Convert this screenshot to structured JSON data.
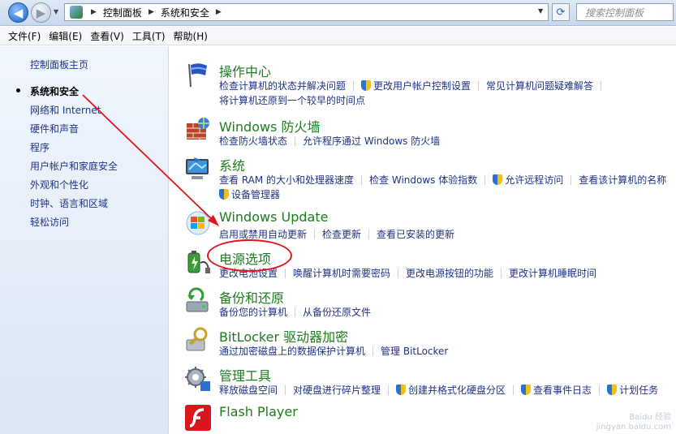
{
  "address_bar": {
    "crumbs": [
      "控制面板",
      "系统和安全"
    ],
    "search_placeholder": "搜索控制面板"
  },
  "menu": [
    "文件(F)",
    "编辑(E)",
    "查看(V)",
    "工具(T)",
    "帮助(H)"
  ],
  "sidebar": {
    "home": "控制面板主页",
    "current": "系统和安全",
    "items": [
      "网络和 Internet",
      "硬件和声音",
      "程序",
      "用户帐户和家庭安全",
      "外观和个性化",
      "时钟、语言和区域",
      "轻松访问"
    ]
  },
  "sections": [
    {
      "title": "操作中心",
      "links": [
        "检查计算机的状态并解决问题",
        "更改用户帐户控制设置",
        "常见计算机问题疑难解答"
      ],
      "links2": [
        "将计算机还原到一个较早的时间点"
      ]
    },
    {
      "title": "Windows 防火墙",
      "links": [
        "检查防火墙状态",
        "允许程序通过 Windows 防火墙"
      ]
    },
    {
      "title": "系统",
      "links": [
        "查看 RAM 的大小和处理器速度",
        "检查 Windows 体验指数",
        "允许远程访问",
        "查看该计算机的名称"
      ],
      "links2": [
        "设备管理器"
      ]
    },
    {
      "title": "Windows Update",
      "links": [
        "启用或禁用自动更新",
        "检查更新",
        "查看已安装的更新"
      ]
    },
    {
      "title": "电源选项",
      "links": [
        "更改电池设置",
        "唤醒计算机时需要密码",
        "更改电源按钮的功能",
        "更改计算机睡眠时间"
      ]
    },
    {
      "title": "备份和还原",
      "links": [
        "备份您的计算机",
        "从备份还原文件"
      ]
    },
    {
      "title": "BitLocker 驱动器加密",
      "links": [
        "通过加密磁盘上的数据保护计算机",
        "管理 BitLocker"
      ]
    },
    {
      "title": "管理工具",
      "links": [
        "释放磁盘空间",
        "对硬盘进行碎片整理",
        "创建并格式化硬盘分区",
        "查看事件日志",
        "计划任务"
      ]
    },
    {
      "title": "Flash Player",
      "links": []
    }
  ],
  "watermark": {
    "line1": "Baidu 经验",
    "line2": "jingyan.baidu.com"
  }
}
